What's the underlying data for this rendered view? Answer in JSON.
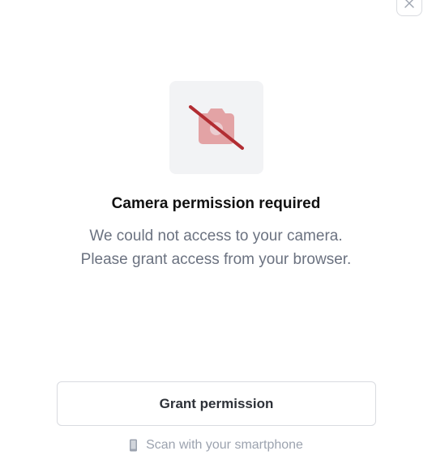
{
  "header": {
    "close_icon": "close-icon"
  },
  "status": {
    "icon": "camera-off-icon",
    "icon_colors": {
      "camera": "#e3a3a5",
      "slash": "#b22d32"
    },
    "title": "Camera permission required",
    "message_line1": "We could not access to your camera.",
    "message_line2": "Please grant access from your browser."
  },
  "actions": {
    "grant_label": "Grant permission",
    "scan_label": "Scan with your smartphone",
    "scan_icon": "smartphone-icon"
  }
}
